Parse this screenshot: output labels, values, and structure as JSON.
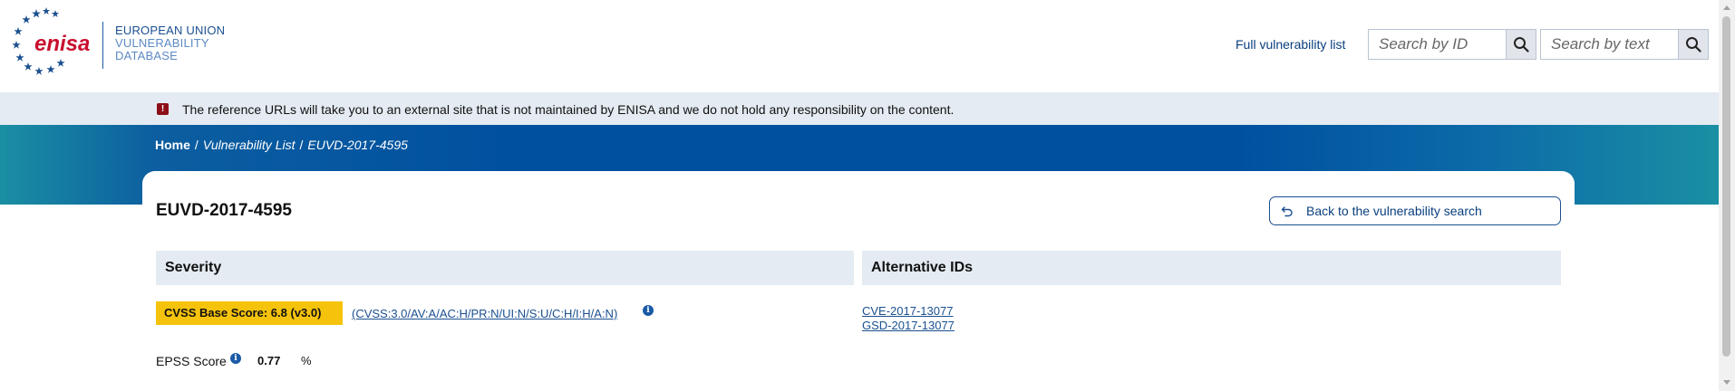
{
  "header": {
    "logo_text": "enisa",
    "database_title": [
      "EUROPEAN UNION",
      "VULNERABILITY",
      "DATABASE"
    ],
    "full_list_link": "Full vulnerability list",
    "search_id_placeholder": "Search by ID",
    "search_text_placeholder": "Search by text"
  },
  "notice": {
    "icon": "alert-icon",
    "text": "The reference URLs will take you to an external site that is not maintained by ENISA and we do not hold any responsibility on the content."
  },
  "breadcrumb": {
    "home": "Home",
    "items": [
      "Vulnerability List",
      "EUVD-2017-4595"
    ]
  },
  "main": {
    "title": "EUVD-2017-4595",
    "back_button": "Back to the vulnerability search",
    "severity": {
      "heading": "Severity",
      "cvss_badge": "CVSS Base Score: 6.8 (v3.0)",
      "cvss_vector": "(CVSS:3.0/AV:A/AC:H/PR:N/UI:N/S:U/C:H/I:H/A:N)",
      "epss_label": "EPSS Score",
      "epss_value": "0.77",
      "epss_unit": "%"
    },
    "alternative_ids": {
      "heading": "Alternative IDs",
      "ids": [
        "CVE-2017-13077",
        "GSD-2017-13077"
      ]
    }
  },
  "colors": {
    "brand_blue": "#0050a0",
    "badge_yellow": "#f5c30c",
    "alert_red": "#8c0e17",
    "link_blue": "#1a4f8f"
  }
}
